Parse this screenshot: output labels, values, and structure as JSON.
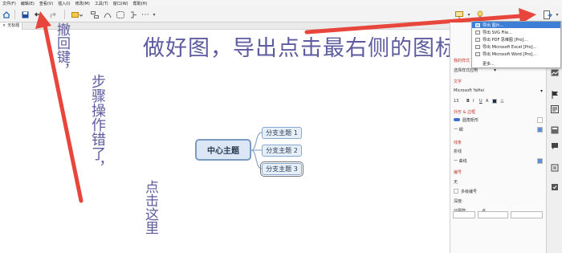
{
  "menubar": {
    "items": [
      "文件(F)",
      "编辑(E)",
      "查看(V)",
      "插入(I)",
      "修改(M)",
      "工具(T)",
      "窗口(W)",
      "帮助(H)"
    ]
  },
  "tab": {
    "label": "无标题"
  },
  "annotations": {
    "title": "做好图，导出点击最右侧的图标",
    "undo_note_1": "撤回键，",
    "undo_note_2": "步骤操作错了，",
    "undo_note_3": "点击这里"
  },
  "mindmap": {
    "central": "中心主题",
    "subtopics": [
      "分支主题 1",
      "分支主题 2",
      "分支主题 3"
    ],
    "selected_index": 2
  },
  "export_menu": {
    "items": [
      "导出 图片...",
      "导出 SVG File...",
      "导出 PDF 思维图 [Pro]...",
      "导出 Microsoft Excel [Pro]...",
      "导出 Microsoft Word [Pro]...",
      "更多..."
    ],
    "highlighted_index": 0
  },
  "format_panel": {
    "my_style_heading": "我的样式",
    "apply_style": "选择样式应用",
    "text_heading": "文字",
    "font_name": "Microsoft YaHei",
    "font_size": "13",
    "format_buttons": [
      "B",
      "I",
      "U",
      "A",
      "三"
    ],
    "shape_heading": "外形 & 边框",
    "shape_value": "圆角矩形",
    "border_value": "一 细",
    "line_heading": "线条",
    "line_type": "折线",
    "line_style": "一 曲线",
    "numbering_heading": "编号",
    "numbering_value": "无",
    "multi_level": "多级编号",
    "depth_label": "深度:",
    "separator_label": "分隔符:",
    "separator_value": "，点"
  },
  "colors": {
    "annotation_text": "#5e5c9e",
    "arrow_red": "#e8453c",
    "node_border": "#7a9cc4",
    "menu_highlight": "#3d7fd6"
  }
}
